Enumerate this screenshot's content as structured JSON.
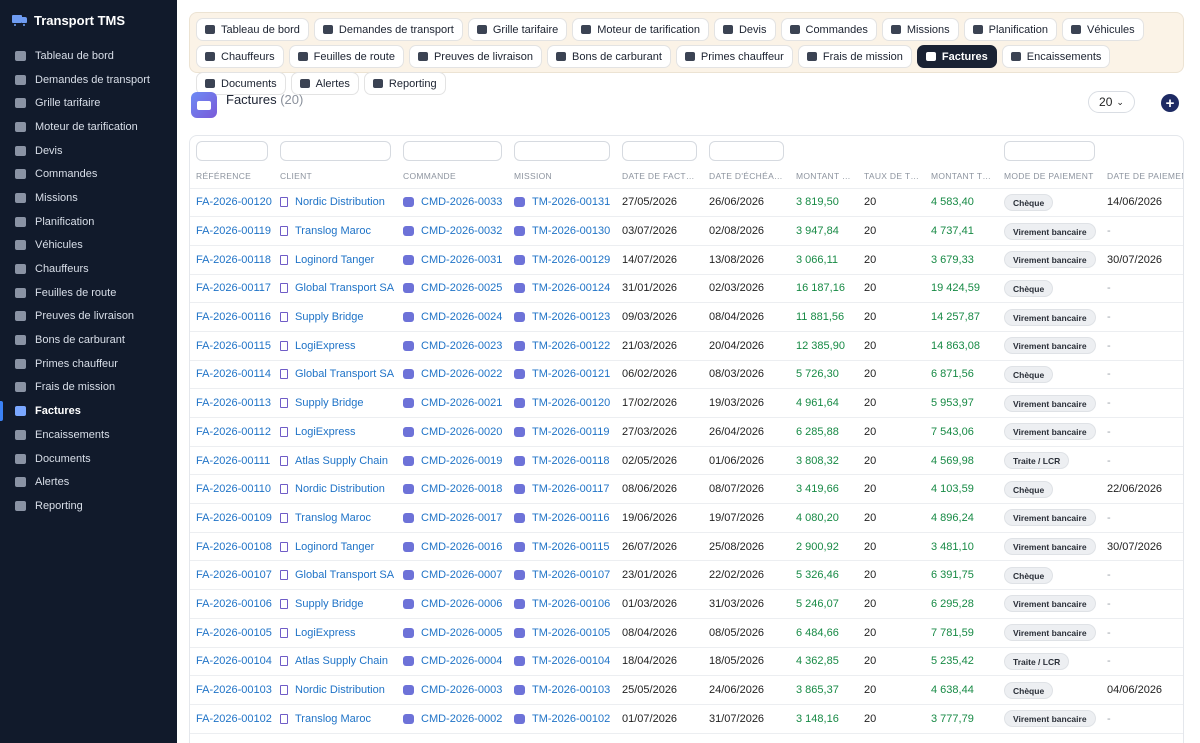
{
  "app": {
    "title": "Transport TMS"
  },
  "sidebar": {
    "items": [
      {
        "label": "Tableau de bord",
        "icon": "dashboard-icon",
        "active": false
      },
      {
        "label": "Demandes de transport",
        "icon": "car-icon",
        "active": false
      },
      {
        "label": "Grille tarifaire",
        "icon": "tag-icon",
        "active": false
      },
      {
        "label": "Moteur de tarification",
        "icon": "calculator-icon",
        "active": false
      },
      {
        "label": "Devis",
        "icon": "file-icon",
        "active": false
      },
      {
        "label": "Commandes",
        "icon": "cart-icon",
        "active": false
      },
      {
        "label": "Missions",
        "icon": "truck-icon",
        "active": false
      },
      {
        "label": "Planification",
        "icon": "calendar-icon",
        "active": false
      },
      {
        "label": "Véhicules",
        "icon": "truck-icon",
        "active": false
      },
      {
        "label": "Chauffeurs",
        "icon": "id-card-icon",
        "active": false
      },
      {
        "label": "Feuilles de route",
        "icon": "route-icon",
        "active": false
      },
      {
        "label": "Preuves de livraison",
        "icon": "clipboard-check-icon",
        "active": false
      },
      {
        "label": "Bons de carburant",
        "icon": "fuel-icon",
        "active": false
      },
      {
        "label": "Primes chauffeur",
        "icon": "gift-icon",
        "active": false
      },
      {
        "label": "Frais de mission",
        "icon": "receipt-icon",
        "active": false
      },
      {
        "label": "Factures",
        "icon": "invoice-icon",
        "active": true
      },
      {
        "label": "Encaissements",
        "icon": "money-icon",
        "active": false
      },
      {
        "label": "Documents",
        "icon": "paperclip-icon",
        "active": false
      },
      {
        "label": "Alertes",
        "icon": "bell-icon",
        "active": false
      },
      {
        "label": "Reporting",
        "icon": "chart-pie-icon",
        "active": false
      }
    ]
  },
  "tabs": [
    {
      "label": "Tableau de bord",
      "icon": "dashboard-icon",
      "active": false
    },
    {
      "label": "Demandes de transport",
      "icon": "car-icon",
      "active": false
    },
    {
      "label": "Grille tarifaire",
      "icon": "tag-icon",
      "active": false
    },
    {
      "label": "Moteur de tarification",
      "icon": "calculator-icon",
      "active": false
    },
    {
      "label": "Devis",
      "icon": "file-icon",
      "active": false
    },
    {
      "label": "Commandes",
      "icon": "cart-icon",
      "active": false
    },
    {
      "label": "Missions",
      "icon": "truck-icon",
      "active": false
    },
    {
      "label": "Planification",
      "icon": "calendar-icon",
      "active": false
    },
    {
      "label": "Véhicules",
      "icon": "truck-icon",
      "active": false
    },
    {
      "label": "Chauffeurs",
      "icon": "id-card-icon",
      "active": false
    },
    {
      "label": "Feuilles de route",
      "icon": "route-icon",
      "active": false
    },
    {
      "label": "Preuves de livraison",
      "icon": "clipboard-check-icon",
      "active": false
    },
    {
      "label": "Bons de carburant",
      "icon": "fuel-icon",
      "active": false
    },
    {
      "label": "Primes chauffeur",
      "icon": "gift-icon",
      "active": false
    },
    {
      "label": "Frais de mission",
      "icon": "receipt-icon",
      "active": false
    },
    {
      "label": "Factures",
      "icon": "invoice-icon",
      "active": true
    },
    {
      "label": "Encaissements",
      "icon": "money-icon",
      "active": false
    },
    {
      "label": "Documents",
      "icon": "paperclip-icon",
      "active": false
    },
    {
      "label": "Alertes",
      "icon": "bell-icon",
      "active": false
    },
    {
      "label": "Reporting",
      "icon": "chart-pie-icon",
      "active": false
    }
  ],
  "header": {
    "title": "Factures",
    "count": "(20)",
    "per_page": "20"
  },
  "table": {
    "columns": [
      "RÉFÉRENCE",
      "CLIENT",
      "COMMANDE",
      "MISSION",
      "DATE DE FACTURATION",
      "DATE D'ÉCHÉANCE",
      "MONTANT HT",
      "TAUX DE TVA",
      "MONTANT TTC",
      "MODE DE PAIEMENT",
      "DATE DE PAIEMENT"
    ],
    "filter_columns": [
      0,
      1,
      2,
      3,
      4,
      5,
      9
    ],
    "rows": [
      [
        "FA-2026-00120",
        "Nordic Distribution",
        "CMD-2026-0033",
        "TM-2026-00131",
        "27/05/2026",
        "26/06/2026",
        "3 819,50",
        "20",
        "4 583,40",
        "Chèque",
        "14/06/2026"
      ],
      [
        "FA-2026-00119",
        "Translog Maroc",
        "CMD-2026-0032",
        "TM-2026-00130",
        "03/07/2026",
        "02/08/2026",
        "3 947,84",
        "20",
        "4 737,41",
        "Virement bancaire",
        "-"
      ],
      [
        "FA-2026-00118",
        "Loginord Tanger",
        "CMD-2026-0031",
        "TM-2026-00129",
        "14/07/2026",
        "13/08/2026",
        "3 066,11",
        "20",
        "3 679,33",
        "Virement bancaire",
        "30/07/2026"
      ],
      [
        "FA-2026-00117",
        "Global Transport SA",
        "CMD-2026-0025",
        "TM-2026-00124",
        "31/01/2026",
        "02/03/2026",
        "16 187,16",
        "20",
        "19 424,59",
        "Chèque",
        "-"
      ],
      [
        "FA-2026-00116",
        "Supply Bridge",
        "CMD-2026-0024",
        "TM-2026-00123",
        "09/03/2026",
        "08/04/2026",
        "11 881,56",
        "20",
        "14 257,87",
        "Virement bancaire",
        "-"
      ],
      [
        "FA-2026-00115",
        "LogiExpress",
        "CMD-2026-0023",
        "TM-2026-00122",
        "21/03/2026",
        "20/04/2026",
        "12 385,90",
        "20",
        "14 863,08",
        "Virement bancaire",
        "-"
      ],
      [
        "FA-2026-00114",
        "Global Transport SA",
        "CMD-2026-0022",
        "TM-2026-00121",
        "06/02/2026",
        "08/03/2026",
        "5 726,30",
        "20",
        "6 871,56",
        "Chèque",
        "-"
      ],
      [
        "FA-2026-00113",
        "Supply Bridge",
        "CMD-2026-0021",
        "TM-2026-00120",
        "17/02/2026",
        "19/03/2026",
        "4 961,64",
        "20",
        "5 953,97",
        "Virement bancaire",
        "-"
      ],
      [
        "FA-2026-00112",
        "LogiExpress",
        "CMD-2026-0020",
        "TM-2026-00119",
        "27/03/2026",
        "26/04/2026",
        "6 285,88",
        "20",
        "7 543,06",
        "Virement bancaire",
        "-"
      ],
      [
        "FA-2026-00111",
        "Atlas Supply Chain",
        "CMD-2026-0019",
        "TM-2026-00118",
        "02/05/2026",
        "01/06/2026",
        "3 808,32",
        "20",
        "4 569,98",
        "Traite / LCR",
        "-"
      ],
      [
        "FA-2026-00110",
        "Nordic Distribution",
        "CMD-2026-0018",
        "TM-2026-00117",
        "08/06/2026",
        "08/07/2026",
        "3 419,66",
        "20",
        "4 103,59",
        "Chèque",
        "22/06/2026"
      ],
      [
        "FA-2026-00109",
        "Translog Maroc",
        "CMD-2026-0017",
        "TM-2026-00116",
        "19/06/2026",
        "19/07/2026",
        "4 080,20",
        "20",
        "4 896,24",
        "Virement bancaire",
        "-"
      ],
      [
        "FA-2026-00108",
        "Loginord Tanger",
        "CMD-2026-0016",
        "TM-2026-00115",
        "26/07/2026",
        "25/08/2026",
        "2 900,92",
        "20",
        "3 481,10",
        "Virement bancaire",
        "30/07/2026"
      ],
      [
        "FA-2026-00107",
        "Global Transport SA",
        "CMD-2026-0007",
        "TM-2026-00107",
        "23/01/2026",
        "22/02/2026",
        "5 326,46",
        "20",
        "6 391,75",
        "Chèque",
        "-"
      ],
      [
        "FA-2026-00106",
        "Supply Bridge",
        "CMD-2026-0006",
        "TM-2026-00106",
        "01/03/2026",
        "31/03/2026",
        "5 246,07",
        "20",
        "6 295,28",
        "Virement bancaire",
        "-"
      ],
      [
        "FA-2026-00105",
        "LogiExpress",
        "CMD-2026-0005",
        "TM-2026-00105",
        "08/04/2026",
        "08/05/2026",
        "6 484,66",
        "20",
        "7 781,59",
        "Virement bancaire",
        "-"
      ],
      [
        "FA-2026-00104",
        "Atlas Supply Chain",
        "CMD-2026-0004",
        "TM-2026-00104",
        "18/04/2026",
        "18/05/2026",
        "4 362,85",
        "20",
        "5 235,42",
        "Traite / LCR",
        "-"
      ],
      [
        "FA-2026-00103",
        "Nordic Distribution",
        "CMD-2026-0003",
        "TM-2026-00103",
        "25/05/2026",
        "24/06/2026",
        "3 865,37",
        "20",
        "4 638,44",
        "Chèque",
        "04/06/2026"
      ],
      [
        "FA-2026-00102",
        "Translog Maroc",
        "CMD-2026-0002",
        "TM-2026-00102",
        "01/07/2026",
        "31/07/2026",
        "3 148,16",
        "20",
        "3 777,79",
        "Virement bancaire",
        "-"
      ]
    ]
  },
  "colors": {
    "sidebar_bg": "#111a2b",
    "accent": "#1a2233",
    "link": "#1f73c7",
    "amount_green": "#178a45",
    "tabs_bg": "#fbf3e7"
  }
}
